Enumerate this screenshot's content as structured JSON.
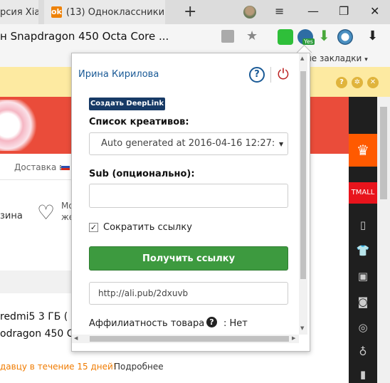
{
  "tabs": [
    {
      "title": "рсия Xia",
      "close": "×"
    },
    {
      "title": "(13) Одноклассники",
      "close": "×",
      "icon": "odnoklassniki-icon",
      "icon_glyph": "ok"
    }
  ],
  "window_controls": {
    "new_tab": "+",
    "menu": "≡",
    "minimize": "—",
    "restore": "❐",
    "close": "✕"
  },
  "address": {
    "text": "н Snapdragon 450 Octa Core ...",
    "star": "★"
  },
  "extensions": {
    "yes_badge": "Yes",
    "download": "⬇"
  },
  "bookmarks": {
    "label": "ие закладки",
    "chevron": "▾"
  },
  "infobar": {
    "help": "?",
    "settings": "✲",
    "close": "✕"
  },
  "page": {
    "delivery": "Доставка в",
    "cart": "зина",
    "heart": "♡",
    "fav_line1": "Мо",
    "fav_line2": "же",
    "product_line1": "redmi5 3 ГБ (",
    "product_line2": "odragon 450 C",
    "seller_notice": "давцу в течение 15 дней!",
    "more": "Подробнее",
    "tmall": "TMALL",
    "crown": "♛",
    "side_icons": [
      "▯",
      "👕",
      "▣",
      "◙",
      "◎",
      "♁",
      "▮"
    ]
  },
  "popup": {
    "user_name": "Ирина Кирилова",
    "help_glyph": "?",
    "power_glyph": "⏻",
    "deeplink_button": "Создать DeepLink",
    "creatives_label": "Список креативов:",
    "creatives_selected": "Auto generated at 2016-04-16 12:27:",
    "select_arrow": "▼",
    "sub_label": "Sub (опционально):",
    "sub_value": "",
    "shorten_label": "Сократить ссылку",
    "shorten_checked": "✓",
    "get_link_button": "Получить ссылку",
    "link_value": "http://ali.pub/2dxuvb",
    "affiliate_label": "Аффилиатность товара",
    "affiliate_q": "?",
    "affiliate_value": ": Нет"
  },
  "colors": {
    "accent": "#1a5a96",
    "primary_button": "#3d9a3f",
    "deeplink": "#173a66",
    "infobar": "#fdeaa1"
  }
}
